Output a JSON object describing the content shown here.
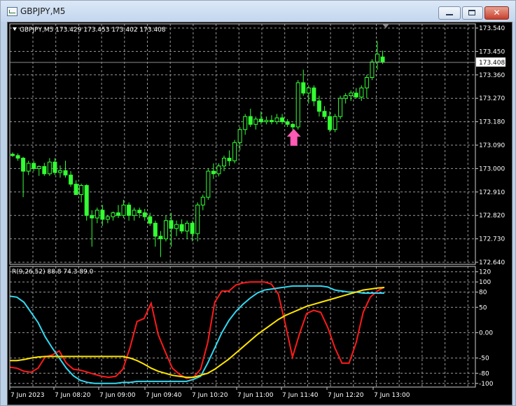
{
  "window": {
    "title": "GBPJPY,M5",
    "minimize_label": "–",
    "maximize_label": "□",
    "close_label": "✕"
  },
  "colors": {
    "background": "#000000",
    "grid": "#9a9a9a",
    "candle": "#33ff33",
    "bid_line": "#8c8c8c",
    "arrow": "#ff5ab4",
    "red_line": "#ff1a1a",
    "cyan_line": "#33d9f2",
    "yellow_line": "#ffe600",
    "axis_text": "#ffffff"
  },
  "main_chart": {
    "legend": "GBPJPY,M5  173.429 173.453 173.402 173.408",
    "legend_icon": "triangle-down-icon",
    "current_price_label": "173.408",
    "price_ticks": [
      "173.540",
      "173.450",
      "173.360",
      "173.270",
      "173.180",
      "173.090",
      "173.000",
      "172.910",
      "172.820",
      "172.730",
      "172.640"
    ],
    "signal_icon": "up-arrow-signal-icon"
  },
  "indicator": {
    "legend": "R(9,26,52) 88.8 74.3 89.0",
    "ticks": [
      "120",
      "100",
      "80",
      "50",
      "0.00",
      "-50",
      "-80",
      "-100"
    ]
  },
  "time_axis": {
    "labels": [
      "7 Jun 2023",
      "7 Jun 08:20",
      "7 Jun 09:00",
      "7 Jun 09:40",
      "7 Jun 10:20",
      "7 Jun 11:00",
      "7 Jun 11:40",
      "7 Jun 12:20",
      "7 Jun 13:00"
    ]
  },
  "chart_data": [
    {
      "type": "candlestick",
      "title": "",
      "symbol": "GBPJPY",
      "timeframe": "M5",
      "ylim": [
        172.64,
        173.54
      ],
      "candles": [
        {
          "o": 173.055,
          "h": 173.062,
          "l": 173.045,
          "c": 173.05
        },
        {
          "o": 173.05,
          "h": 173.058,
          "l": 173.03,
          "c": 173.04
        },
        {
          "o": 173.04,
          "h": 173.045,
          "l": 172.89,
          "c": 172.99
        },
        {
          "o": 172.99,
          "h": 173.03,
          "l": 172.975,
          "c": 173.02
        },
        {
          "o": 173.02,
          "h": 173.03,
          "l": 172.99,
          "c": 173.0
        },
        {
          "o": 173.0,
          "h": 173.012,
          "l": 172.972,
          "c": 173.008
        },
        {
          "o": 173.008,
          "h": 173.022,
          "l": 172.972,
          "c": 172.98
        },
        {
          "o": 172.98,
          "h": 173.04,
          "l": 172.972,
          "c": 173.025
        },
        {
          "o": 173.025,
          "h": 173.04,
          "l": 172.975,
          "c": 172.985
        },
        {
          "o": 172.985,
          "h": 173.012,
          "l": 172.965,
          "c": 172.992
        },
        {
          "o": 172.992,
          "h": 173.03,
          "l": 172.965,
          "c": 172.975
        },
        {
          "o": 172.975,
          "h": 172.99,
          "l": 172.93,
          "c": 172.94
        },
        {
          "o": 172.94,
          "h": 172.955,
          "l": 172.9,
          "c": 172.9
        },
        {
          "o": 172.9,
          "h": 172.942,
          "l": 172.87,
          "c": 172.935
        },
        {
          "o": 172.935,
          "h": 172.94,
          "l": 172.8,
          "c": 172.82
        },
        {
          "o": 172.82,
          "h": 172.84,
          "l": 172.7,
          "c": 172.81
        },
        {
          "o": 172.81,
          "h": 172.85,
          "l": 172.79,
          "c": 172.84
        },
        {
          "o": 172.84,
          "h": 172.86,
          "l": 172.78,
          "c": 172.805
        },
        {
          "o": 172.805,
          "h": 172.822,
          "l": 172.79,
          "c": 172.815
        },
        {
          "o": 172.815,
          "h": 172.835,
          "l": 172.8,
          "c": 172.83
        },
        {
          "o": 172.83,
          "h": 172.86,
          "l": 172.81,
          "c": 172.82
        },
        {
          "o": 172.82,
          "h": 172.88,
          "l": 172.81,
          "c": 172.86
        },
        {
          "o": 172.86,
          "h": 172.87,
          "l": 172.8,
          "c": 172.82
        },
        {
          "o": 172.82,
          "h": 172.85,
          "l": 172.8,
          "c": 172.84
        },
        {
          "o": 172.84,
          "h": 172.85,
          "l": 172.81,
          "c": 172.83
        },
        {
          "o": 172.83,
          "h": 172.845,
          "l": 172.8,
          "c": 172.815
        },
        {
          "o": 172.815,
          "h": 172.83,
          "l": 172.78,
          "c": 172.79
        },
        {
          "o": 172.79,
          "h": 172.8,
          "l": 172.7,
          "c": 172.74
        },
        {
          "o": 172.74,
          "h": 172.76,
          "l": 172.66,
          "c": 172.73
        },
        {
          "o": 172.73,
          "h": 172.82,
          "l": 172.72,
          "c": 172.8
        },
        {
          "o": 172.8,
          "h": 172.83,
          "l": 172.7,
          "c": 172.77
        },
        {
          "o": 172.77,
          "h": 172.8,
          "l": 172.74,
          "c": 172.785
        },
        {
          "o": 172.785,
          "h": 172.805,
          "l": 172.75,
          "c": 172.76
        },
        {
          "o": 172.76,
          "h": 172.8,
          "l": 172.73,
          "c": 172.79
        },
        {
          "o": 172.79,
          "h": 172.8,
          "l": 172.72,
          "c": 172.75
        },
        {
          "o": 172.75,
          "h": 172.87,
          "l": 172.72,
          "c": 172.86
        },
        {
          "o": 172.86,
          "h": 172.9,
          "l": 172.84,
          "c": 172.89
        },
        {
          "o": 172.89,
          "h": 173.0,
          "l": 172.88,
          "c": 172.99
        },
        {
          "o": 172.99,
          "h": 173.02,
          "l": 172.96,
          "c": 172.98
        },
        {
          "o": 172.98,
          "h": 173.02,
          "l": 172.97,
          "c": 173.01
        },
        {
          "o": 173.01,
          "h": 173.05,
          "l": 172.99,
          "c": 173.04
        },
        {
          "o": 173.04,
          "h": 173.07,
          "l": 173.01,
          "c": 173.03
        },
        {
          "o": 173.03,
          "h": 173.11,
          "l": 173.02,
          "c": 173.1
        },
        {
          "o": 173.1,
          "h": 173.16,
          "l": 173.07,
          "c": 173.15
        },
        {
          "o": 173.15,
          "h": 173.21,
          "l": 173.13,
          "c": 173.2
        },
        {
          "o": 173.2,
          "h": 173.23,
          "l": 173.16,
          "c": 173.17
        },
        {
          "o": 173.17,
          "h": 173.2,
          "l": 173.15,
          "c": 173.19
        },
        {
          "o": 173.19,
          "h": 173.22,
          "l": 173.17,
          "c": 173.18
        },
        {
          "o": 173.18,
          "h": 173.2,
          "l": 173.17,
          "c": 173.185
        },
        {
          "o": 173.185,
          "h": 173.205,
          "l": 173.17,
          "c": 173.18
        },
        {
          "o": 173.18,
          "h": 173.21,
          "l": 173.17,
          "c": 173.195
        },
        {
          "o": 173.195,
          "h": 173.21,
          "l": 173.17,
          "c": 173.18
        },
        {
          "o": 173.18,
          "h": 173.19,
          "l": 173.16,
          "c": 173.17
        },
        {
          "o": 173.17,
          "h": 173.175,
          "l": 173.13,
          "c": 173.16
        },
        {
          "o": 173.16,
          "h": 173.34,
          "l": 173.15,
          "c": 173.33
        },
        {
          "o": 173.33,
          "h": 173.38,
          "l": 173.28,
          "c": 173.29
        },
        {
          "o": 173.29,
          "h": 173.32,
          "l": 173.25,
          "c": 173.31
        },
        {
          "o": 173.31,
          "h": 173.32,
          "l": 173.24,
          "c": 173.26
        },
        {
          "o": 173.26,
          "h": 173.28,
          "l": 173.2,
          "c": 173.22
        },
        {
          "o": 173.22,
          "h": 173.24,
          "l": 173.19,
          "c": 173.2
        },
        {
          "o": 173.2,
          "h": 173.22,
          "l": 173.14,
          "c": 173.15
        },
        {
          "o": 173.15,
          "h": 173.21,
          "l": 173.14,
          "c": 173.2
        },
        {
          "o": 173.2,
          "h": 173.28,
          "l": 173.19,
          "c": 173.27
        },
        {
          "o": 173.27,
          "h": 173.29,
          "l": 173.25,
          "c": 173.28
        },
        {
          "o": 173.28,
          "h": 173.3,
          "l": 173.26,
          "c": 173.29
        },
        {
          "o": 173.29,
          "h": 173.31,
          "l": 173.27,
          "c": 173.275
        },
        {
          "o": 173.275,
          "h": 173.32,
          "l": 173.26,
          "c": 173.31
        },
        {
          "o": 173.31,
          "h": 173.36,
          "l": 173.27,
          "c": 173.35
        },
        {
          "o": 173.35,
          "h": 173.42,
          "l": 173.34,
          "c": 173.41
        },
        {
          "o": 173.41,
          "h": 173.49,
          "l": 173.38,
          "c": 173.44
        },
        {
          "o": 173.429,
          "h": 173.453,
          "l": 173.402,
          "c": 173.408
        }
      ],
      "current_price": 173.408,
      "signal": {
        "type": "buy-arrow",
        "candle_index": 54,
        "price": 173.12
      }
    },
    {
      "type": "line",
      "title": "",
      "ylim": [
        -110,
        125
      ],
      "yticks": [
        120,
        100,
        80,
        50,
        0,
        -50,
        -80,
        -100
      ],
      "series": [
        {
          "color": "#ff1a1a",
          "values": [
            -68,
            -70,
            -76,
            -78,
            -70,
            -48,
            -44,
            -36,
            -60,
            -72,
            -74,
            -78,
            -82,
            -86,
            -88,
            -86,
            -72,
            -30,
            22,
            28,
            58,
            -4,
            -38,
            -70,
            -82,
            -90,
            -88,
            -72,
            -20,
            60,
            82,
            82,
            94,
            98,
            100,
            100,
            100,
            96,
            76,
            16,
            -48,
            -2,
            38,
            44,
            40,
            10,
            -30,
            -60,
            -60,
            -20,
            40,
            70,
            82,
            90
          ]
        },
        {
          "color": "#33d9f2",
          "values": [
            72,
            70,
            60,
            40,
            20,
            -8,
            -30,
            -50,
            -70,
            -85,
            -94,
            -98,
            -100,
            -100,
            -100,
            -100,
            -98,
            -98,
            -96,
            -96,
            -96,
            -96,
            -96,
            -96,
            -96,
            -96,
            -92,
            -86,
            -60,
            -30,
            0,
            24,
            42,
            56,
            68,
            78,
            84,
            86,
            88,
            90,
            92,
            92,
            92,
            92,
            92,
            90,
            84,
            82,
            80,
            80,
            78,
            78,
            78,
            78
          ]
        },
        {
          "color": "#ffe600",
          "values": [
            -55,
            -55,
            -53,
            -50,
            -48,
            -47,
            -47,
            -47,
            -47,
            -47,
            -47,
            -47,
            -47,
            -47,
            -47,
            -47,
            -47,
            -50,
            -55,
            -62,
            -70,
            -76,
            -80,
            -84,
            -86,
            -88,
            -88,
            -84,
            -80,
            -72,
            -62,
            -52,
            -40,
            -28,
            -16,
            -4,
            6,
            16,
            26,
            34,
            40,
            46,
            52,
            56,
            60,
            64,
            68,
            72,
            76,
            80,
            84,
            86,
            88,
            89
          ]
        }
      ]
    }
  ]
}
